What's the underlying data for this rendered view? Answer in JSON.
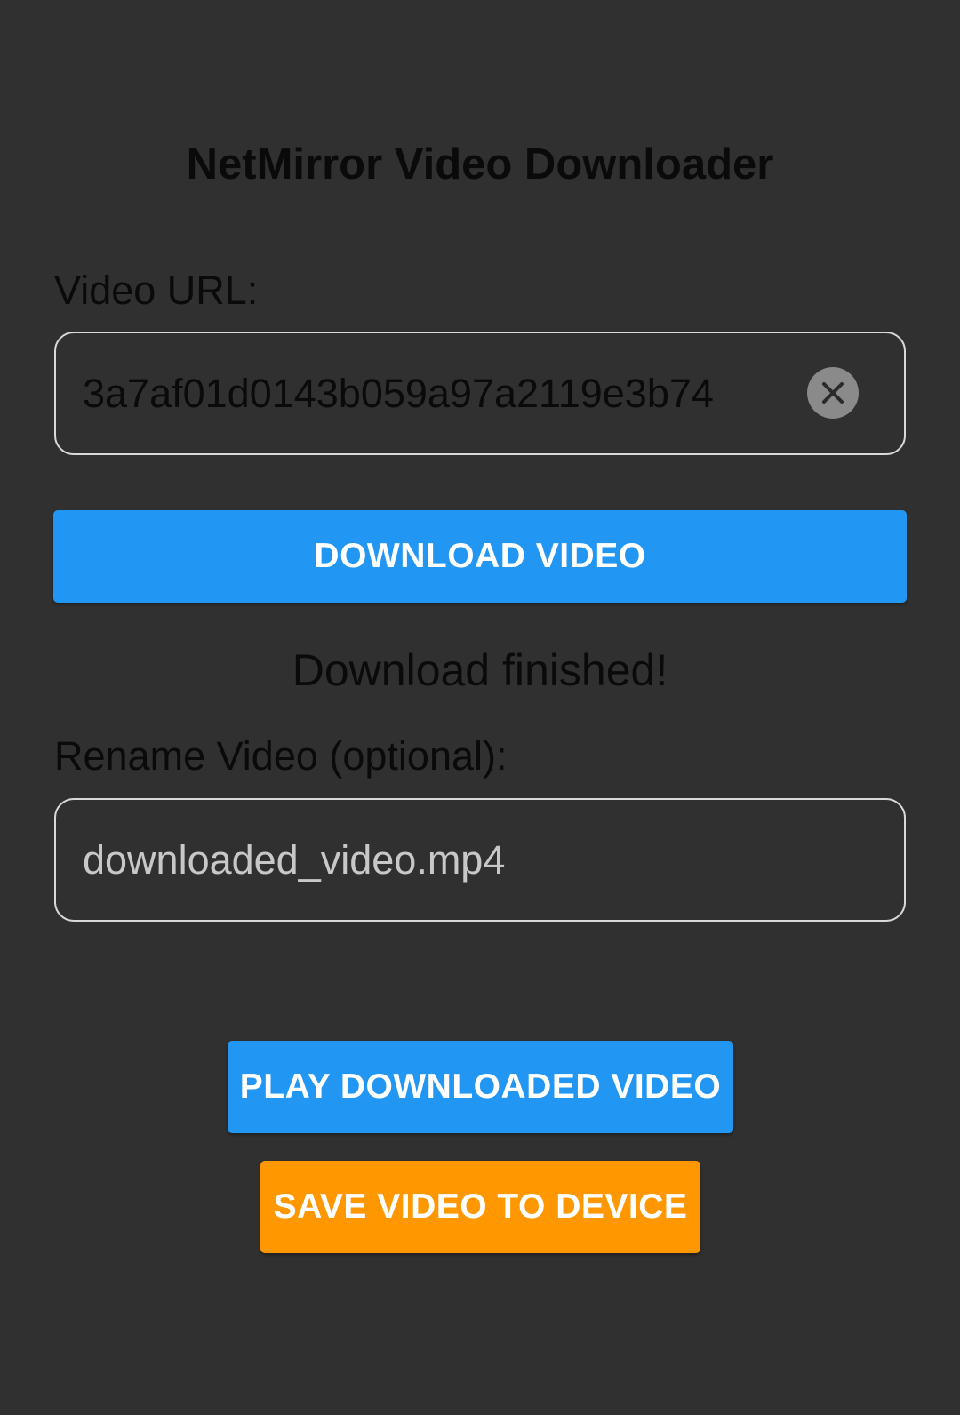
{
  "app": {
    "title": "NetMirror Video Downloader"
  },
  "url_field": {
    "label": "Video URL:",
    "value": "3a7af01d0143b059a97a2119e3b74",
    "clear_icon": "close-icon"
  },
  "download_button": {
    "label": "DOWNLOAD VIDEO"
  },
  "status": {
    "text": "Download finished!"
  },
  "rename_field": {
    "label": "Rename Video (optional):",
    "value": "downloaded_video.mp4"
  },
  "play_button": {
    "label": "PLAY DOWNLOADED VIDEO"
  },
  "save_button": {
    "label": "SAVE VIDEO TO DEVICE"
  },
  "colors": {
    "background": "#303030",
    "primary": "#2196f3",
    "accent": "#ff9800",
    "field_border": "#d9d9d9"
  }
}
